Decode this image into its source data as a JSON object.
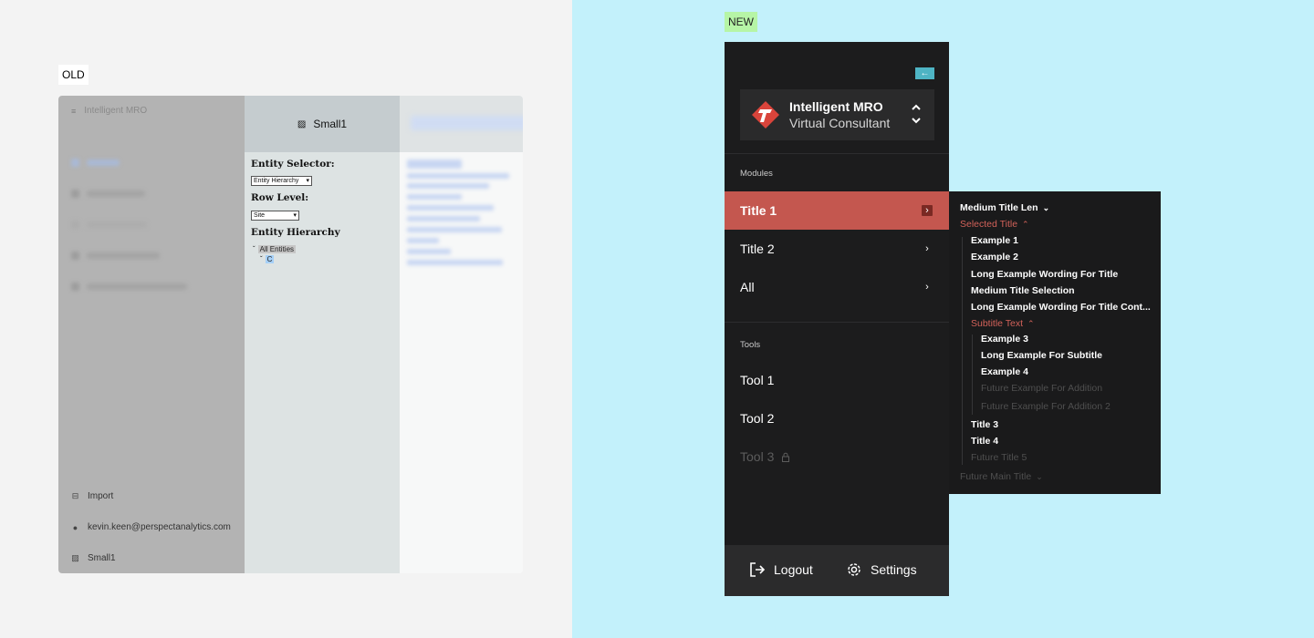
{
  "labels": {
    "old": "OLD",
    "new": "NEW"
  },
  "old": {
    "app_title": "Intelligent MRO",
    "footer": {
      "import": "Import",
      "user": "kevin.keen@perspectanalytics.com",
      "site": "Small1"
    },
    "mid": {
      "header": "Small1",
      "entity_selector_label": "Entity Selector:",
      "entity_selector_value": "Entity Hierarchy",
      "row_level_label": "Row Level:",
      "row_level_value": "Site",
      "hierarchy_label": "Entity Hierarchy",
      "tree_root": "All Entities",
      "tree_child": "C"
    }
  },
  "new": {
    "brand": {
      "name": "Intelligent MRO",
      "subtitle": "Virtual Consultant"
    },
    "modules_label": "Modules",
    "modules": [
      {
        "label": "Title 1",
        "active": true
      },
      {
        "label": "Title 2",
        "active": false
      },
      {
        "label": "All",
        "active": false
      }
    ],
    "tools_label": "Tools",
    "tools": [
      {
        "label": "Tool 1",
        "disabled": false
      },
      {
        "label": "Tool 2",
        "disabled": false
      },
      {
        "label": "Tool 3",
        "disabled": true
      }
    ],
    "footer": {
      "logout": "Logout",
      "settings": "Settings"
    },
    "accent_color": "#c4574f",
    "collapse_color": "#4eb4c4"
  },
  "submenu": {
    "top": "Medium Title Len",
    "selected": "Selected Title",
    "items": [
      "Example 1",
      "Example 2",
      "Long Example Wording For Title",
      "Medium Title Selection",
      "Long Example Wording For Title Cont..."
    ],
    "subtitle": "Subtitle Text",
    "sub_items": [
      "Example 3",
      "Long Example For Subtitle",
      "Example 4"
    ],
    "future_sub_items": [
      "Future Example For Addition",
      "Future Example For Addition 2"
    ],
    "more_items": [
      "Title 3",
      "Title 4"
    ],
    "future_item": "Future Title 5",
    "future_main": "Future Main Title"
  }
}
